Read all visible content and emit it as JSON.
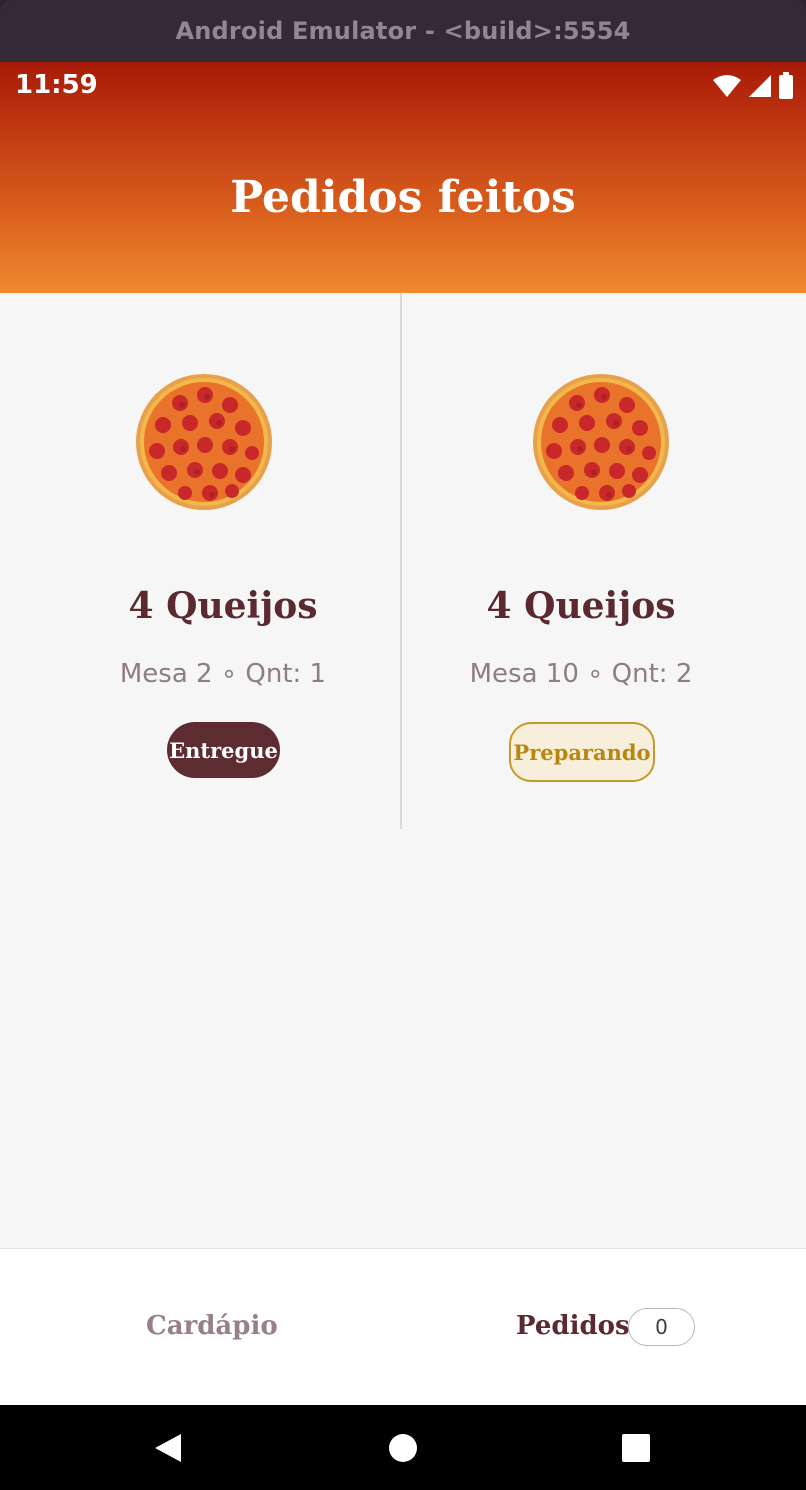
{
  "window": {
    "title": "Android Emulator - <build>:5554"
  },
  "status_bar": {
    "time": "11:59",
    "icons": [
      "wifi-icon",
      "signal-icon",
      "battery-icon"
    ],
    "color": "#ffffff"
  },
  "header": {
    "title": "Pedidos feitos",
    "gradient": [
      "#a71a06",
      "#f08a2e"
    ]
  },
  "orders": [
    {
      "image": "pizza-icon",
      "name": "4 Queijos",
      "meta": "Mesa 2 ∘ Qnt: 1",
      "status": "Entregue",
      "status_color": "#5d2c31"
    },
    {
      "image": "pizza-icon",
      "name": "4 Queijos",
      "meta": "Mesa 10 ∘ Qnt: 2",
      "status": "Preparando",
      "status_color": "#b8870f"
    }
  ],
  "bottom_nav": {
    "items": [
      {
        "label": "Cardápio",
        "active": false
      },
      {
        "label": "Pedidos",
        "active": true,
        "count": "0"
      }
    ]
  },
  "system_nav": [
    "back-icon",
    "home-icon",
    "recents-icon"
  ]
}
